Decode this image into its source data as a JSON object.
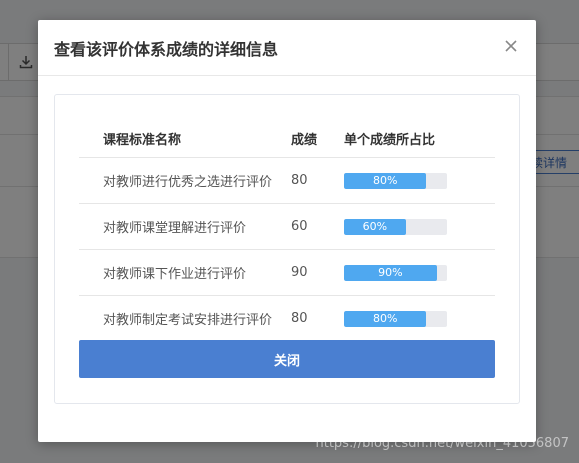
{
  "background": {
    "detail_button_label": "续详情",
    "download_icon": "download-icon"
  },
  "modal": {
    "title": "查看该评价体系成绩的详细信息",
    "close_icon": "close-icon",
    "table": {
      "headers": [
        "课程标准名称",
        "成绩",
        "单个成绩所占比"
      ],
      "rows": [
        {
          "name": "对教师进行优秀之选进行评价",
          "score": "80",
          "percent_label": "80%",
          "percent": 80
        },
        {
          "name": "对教师课堂理解进行评价",
          "score": "60",
          "percent_label": "60%",
          "percent": 60
        },
        {
          "name": "对教师课下作业进行评价",
          "score": "90",
          "percent_label": "90%",
          "percent": 90
        },
        {
          "name": "对教师制定考试安排进行评价",
          "score": "80",
          "percent_label": "80%",
          "percent": 80
        }
      ]
    },
    "close_button_label": "关闭"
  },
  "watermark": "https://blog.csdn.net/weixin_41056807",
  "colors": {
    "primary": "#4a7fd1",
    "progress": "#4fa8f0",
    "overlay": "rgba(0,0,0,0.5)"
  }
}
